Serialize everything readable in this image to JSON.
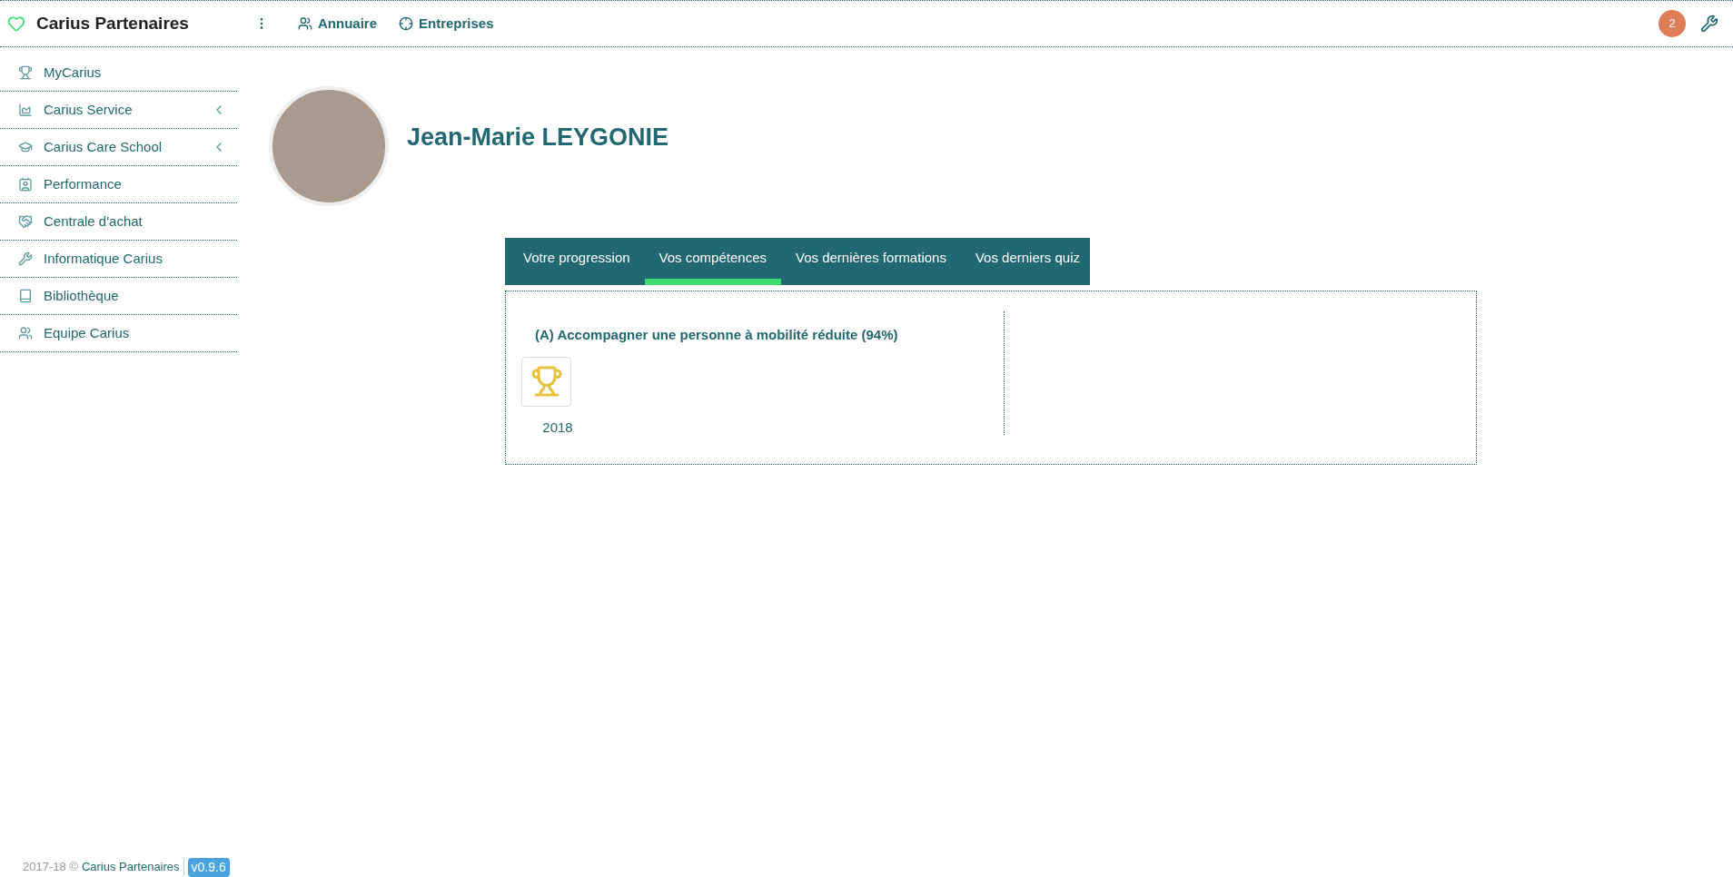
{
  "header": {
    "brand": "Carius Partenaires",
    "nav": [
      {
        "label": "Annuaire"
      },
      {
        "label": "Entreprises"
      }
    ],
    "notification_count": "2"
  },
  "sidebar": {
    "items": [
      {
        "label": "MyCarius",
        "expandable": false
      },
      {
        "label": "Carius Service",
        "expandable": true
      },
      {
        "label": "Carius Care School",
        "expandable": true
      },
      {
        "label": "Performance",
        "expandable": false
      },
      {
        "label": "Centrale d'achat",
        "expandable": false
      },
      {
        "label": "Informatique Carius",
        "expandable": false
      },
      {
        "label": "Bibliothèque",
        "expandable": false
      },
      {
        "label": "Equipe Carius",
        "expandable": false
      }
    ]
  },
  "profile": {
    "name": "Jean-Marie LEYGONIE"
  },
  "tabs": [
    {
      "label": "Votre progression",
      "selected": false
    },
    {
      "label": "Vos compétences",
      "selected": true
    },
    {
      "label": "Vos dernières formations",
      "selected": false
    },
    {
      "label": "Vos derniers quiz",
      "selected": false
    }
  ],
  "skills": [
    {
      "title": "(A) Accompagner une personne à mobilité réduite (94%)",
      "awards": [
        {
          "year": "2018"
        }
      ]
    }
  ],
  "footer": {
    "copyright": "2017-18 ©",
    "link": "Carius Partenaires",
    "version": "v0.9.6"
  }
}
